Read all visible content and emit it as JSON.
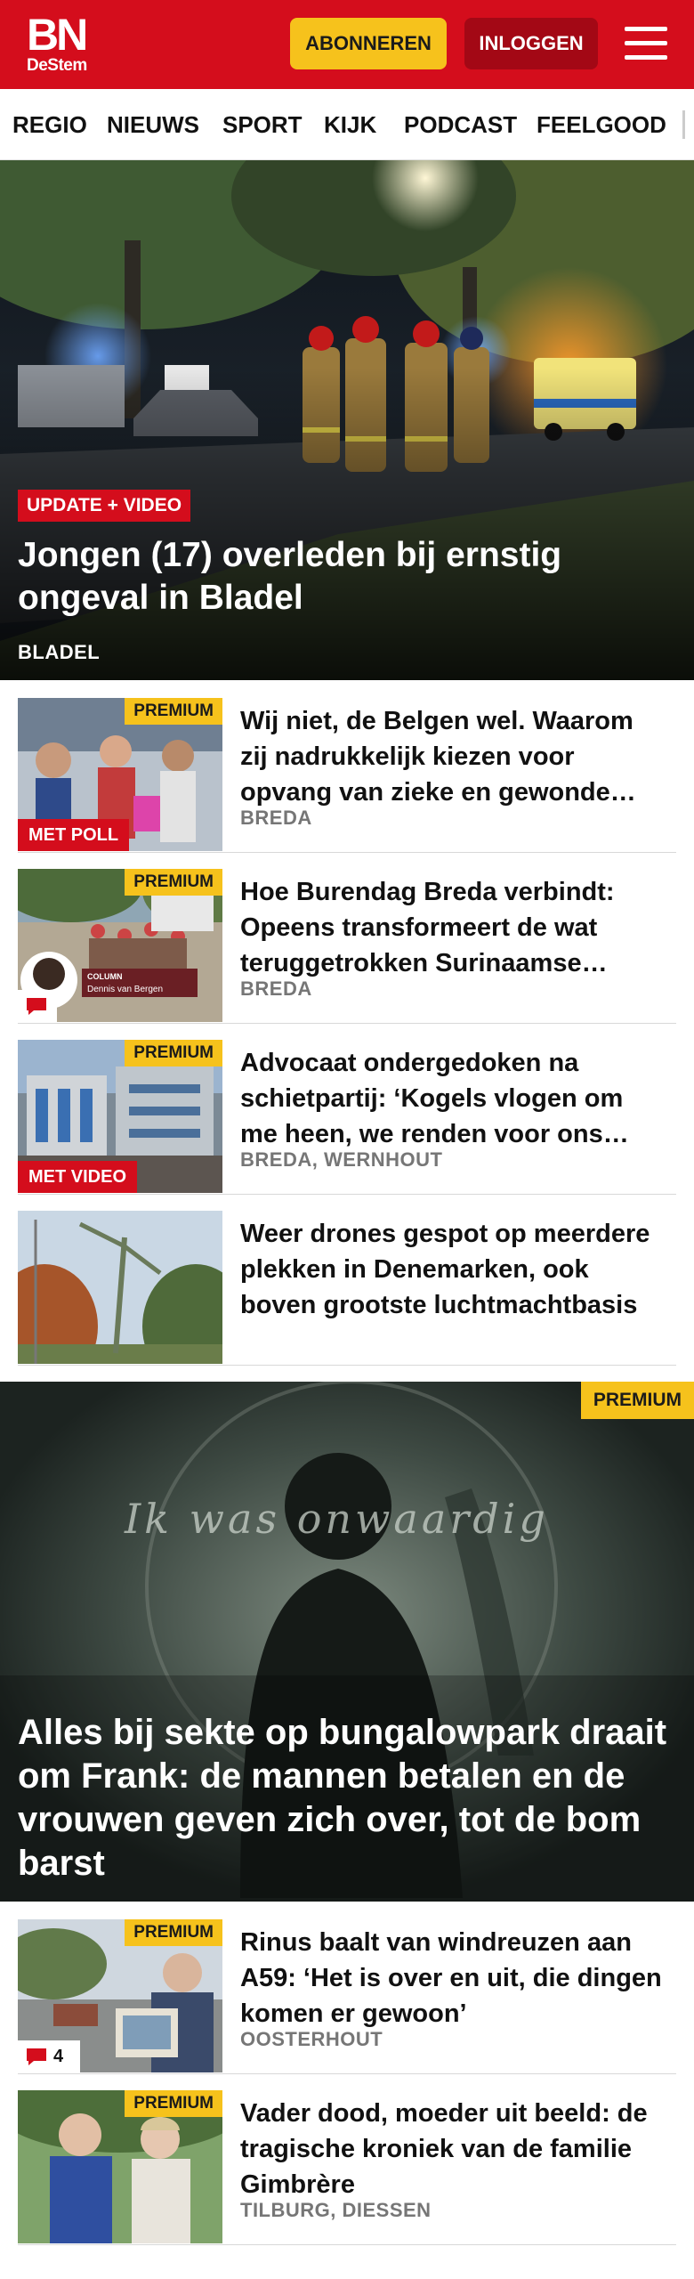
{
  "header": {
    "logo_main": "BN",
    "logo_sub": "DeStem",
    "subscribe_label": "ABONNEREN",
    "login_label": "INLOGGEN",
    "brand_red": "#d40d1c",
    "accent_yellow": "#f6c21c",
    "menu_icon": "hamburger-icon"
  },
  "nav": {
    "items": [
      "REGIO",
      "NIEUWS",
      "SPORT",
      "KIJK",
      "PODCAST",
      "FEELGOOD"
    ]
  },
  "hero": {
    "tag": "UPDATE + VIDEO",
    "title": "Jongen (17) overleden bij ernstig ongeval in Bladel",
    "location": "BLADEL"
  },
  "articles": [
    {
      "badge": "PREMIUM",
      "tag": "MET POLL",
      "title": "Wij niet, de Belgen wel. Waarom zij nadrukkelijk kiezen voor opvang van zieke en gewonde…",
      "location": "BREDA"
    },
    {
      "badge": "PREMIUM",
      "column_label": "COLUMN",
      "column_author": "Dennis van Bergen",
      "title": "Hoe Burendag Breda verbindt: Opeens transformeert de wat teruggetrokken Surinaamse…",
      "location": "BREDA"
    },
    {
      "badge": "PREMIUM",
      "tag": "MET VIDEO",
      "title": "Advocaat ondergedoken na schietpartij: ‘Kogels vlogen om me heen, we renden voor ons…",
      "location": "BREDA, WERNHOUT"
    },
    {
      "title": "Weer drones gespot op meerdere plekken in Denemarken, ook boven grootste luchtmachtbasis"
    }
  ],
  "feature": {
    "badge": "PREMIUM",
    "overlay_text": "Ik was onwaardig",
    "title": "Alles bij sekte op bungalowpark draait om Frank: de mannen betalen en de vrouwen geven zich over, tot de bom barst"
  },
  "articles2": [
    {
      "badge": "PREMIUM",
      "comments": "4",
      "title": "Rinus baalt van windreuzen aan A59: ‘Het is over en uit, die dingen komen er gewoon’",
      "location": "OOSTERHOUT"
    },
    {
      "badge": "PREMIUM",
      "title": "Vader dood, moeder uit beeld: de tragische kroniek van de familie Gimbrère",
      "location": "TILBURG, DIESSEN"
    }
  ]
}
